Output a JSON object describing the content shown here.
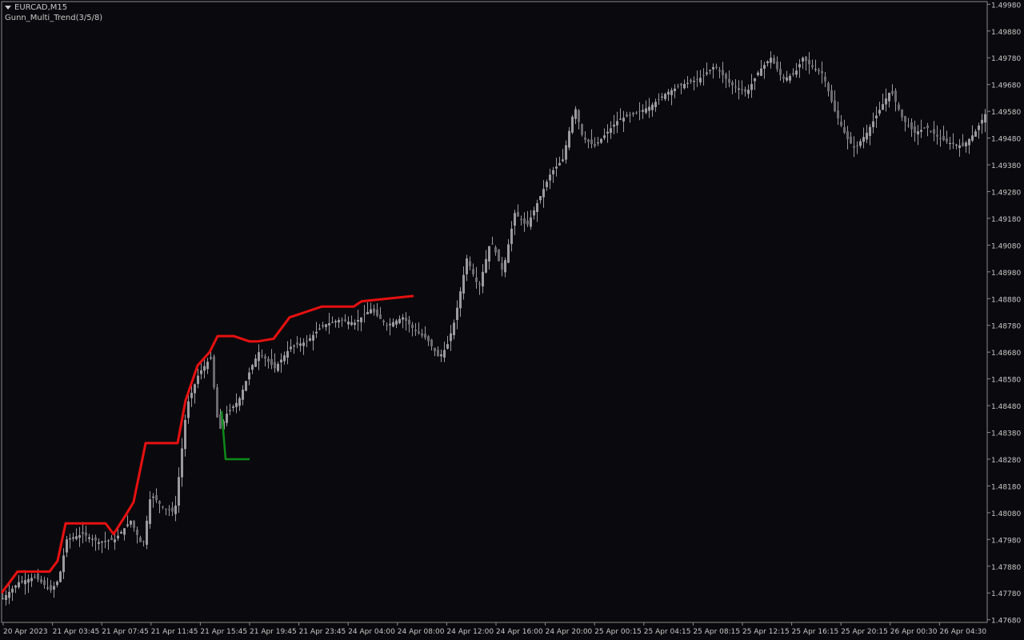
{
  "header": {
    "symbol": "EURCAD,M15",
    "indicator": "Gunn_Multi_Trend(3/5/8)"
  },
  "colors": {
    "background": "#0a0a0e",
    "candle": "#9a9aa0",
    "up_line": "#e81010",
    "down_line": "#0d8a18",
    "axis": "#8a8a8a",
    "text": "#c8c8c8"
  },
  "chart_data": {
    "type": "line",
    "ylim": [
      1.4767,
      1.4999
    ],
    "y_ticks": [
      "1.49980",
      "1.49880",
      "1.49780",
      "1.49680",
      "1.49580",
      "1.49480",
      "1.49380",
      "1.49280",
      "1.49180",
      "1.49080",
      "1.48980",
      "1.48880",
      "1.48780",
      "1.48680",
      "1.48580",
      "1.48480",
      "1.48380",
      "1.48280",
      "1.48180",
      "1.48080",
      "1.47980",
      "1.47880",
      "1.47780",
      "1.47680"
    ],
    "x_ticks": [
      "20 Apr 2023",
      "21 Apr 03:45",
      "21 Apr 07:45",
      "21 Apr 11:45",
      "21 Apr 15:45",
      "21 Apr 19:45",
      "21 Apr 23:45",
      "24 Apr 04:00",
      "24 Apr 08:00",
      "24 Apr 12:00",
      "24 Apr 16:00",
      "24 Apr 20:00",
      "25 Apr 00:15",
      "25 Apr 04:15",
      "25 Apr 08:15",
      "25 Apr 12:15",
      "25 Apr 16:15",
      "25 Apr 20:15",
      "26 Apr 00:30",
      "26 Apr 04:30"
    ],
    "series": [
      {
        "key": "close",
        "x": [
          0,
          20,
          40,
          60,
          70,
          80,
          100,
          120,
          140,
          160,
          175,
          185,
          200,
          215,
          230,
          245,
          260,
          270,
          280,
          295,
          310,
          320,
          340,
          360,
          380,
          400,
          420,
          440,
          460,
          480,
          500,
          515,
          530,
          545,
          555,
          565,
          580,
          595,
          610,
          625,
          640,
          655,
          670,
          685,
          700,
          715,
          725,
          740,
          755,
          770,
          790,
          810,
          830,
          850,
          870,
          890,
          910,
          930,
          945,
          960,
          975,
          990,
          1000,
          1010,
          1025,
          1040,
          1055,
          1065,
          1080,
          1095,
          1110,
          1125,
          1140,
          1155,
          1170,
          1185,
          1200,
          1215,
          1230
        ],
        "values": [
          1.4776,
          1.4782,
          1.4784,
          1.4779,
          1.4783,
          1.4798,
          1.48,
          1.4797,
          1.4798,
          1.4805,
          1.4795,
          1.4815,
          1.481,
          1.4808,
          1.4848,
          1.486,
          1.4866,
          1.4838,
          1.4845,
          1.485,
          1.4862,
          1.4868,
          1.4862,
          1.487,
          1.4872,
          1.4878,
          1.488,
          1.4879,
          1.4884,
          1.4878,
          1.4881,
          1.4876,
          1.4873,
          1.4866,
          1.487,
          1.488,
          1.4903,
          1.4892,
          1.491,
          1.4898,
          1.492,
          1.4915,
          1.4925,
          1.4935,
          1.494,
          1.496,
          1.4948,
          1.4945,
          1.495,
          1.4955,
          1.4957,
          1.496,
          1.4965,
          1.4968,
          1.497,
          1.4975,
          1.4968,
          1.4965,
          1.4973,
          1.4978,
          1.497,
          1.4972,
          1.4978,
          1.4975,
          1.4972,
          1.4958,
          1.4948,
          1.4944,
          1.495,
          1.4958,
          1.4966,
          1.4955,
          1.495,
          1.4952,
          1.4948,
          1.4946,
          1.4945,
          1.495,
          1.4958
        ]
      },
      {
        "key": "up_line",
        "x": [
          0,
          20,
          30,
          60,
          70,
          80,
          130,
          140,
          155,
          165,
          180,
          220,
          230,
          245,
          260,
          270,
          290,
          310,
          320,
          340,
          360,
          380,
          400,
          440,
          450,
          515
        ],
        "values": [
          1.4778,
          1.4786,
          1.4786,
          1.4786,
          1.479,
          1.4804,
          1.4804,
          1.48,
          1.4807,
          1.4812,
          1.4834,
          1.4834,
          1.485,
          1.4863,
          1.4868,
          1.4874,
          1.4874,
          1.4872,
          1.4872,
          1.4873,
          1.4881,
          1.4883,
          1.4885,
          1.4885,
          1.4887,
          1.4889
        ]
      },
      {
        "key": "down_line",
        "x": [
          275,
          280,
          310
        ],
        "values": [
          1.4846,
          1.4828,
          1.4828
        ]
      }
    ]
  }
}
